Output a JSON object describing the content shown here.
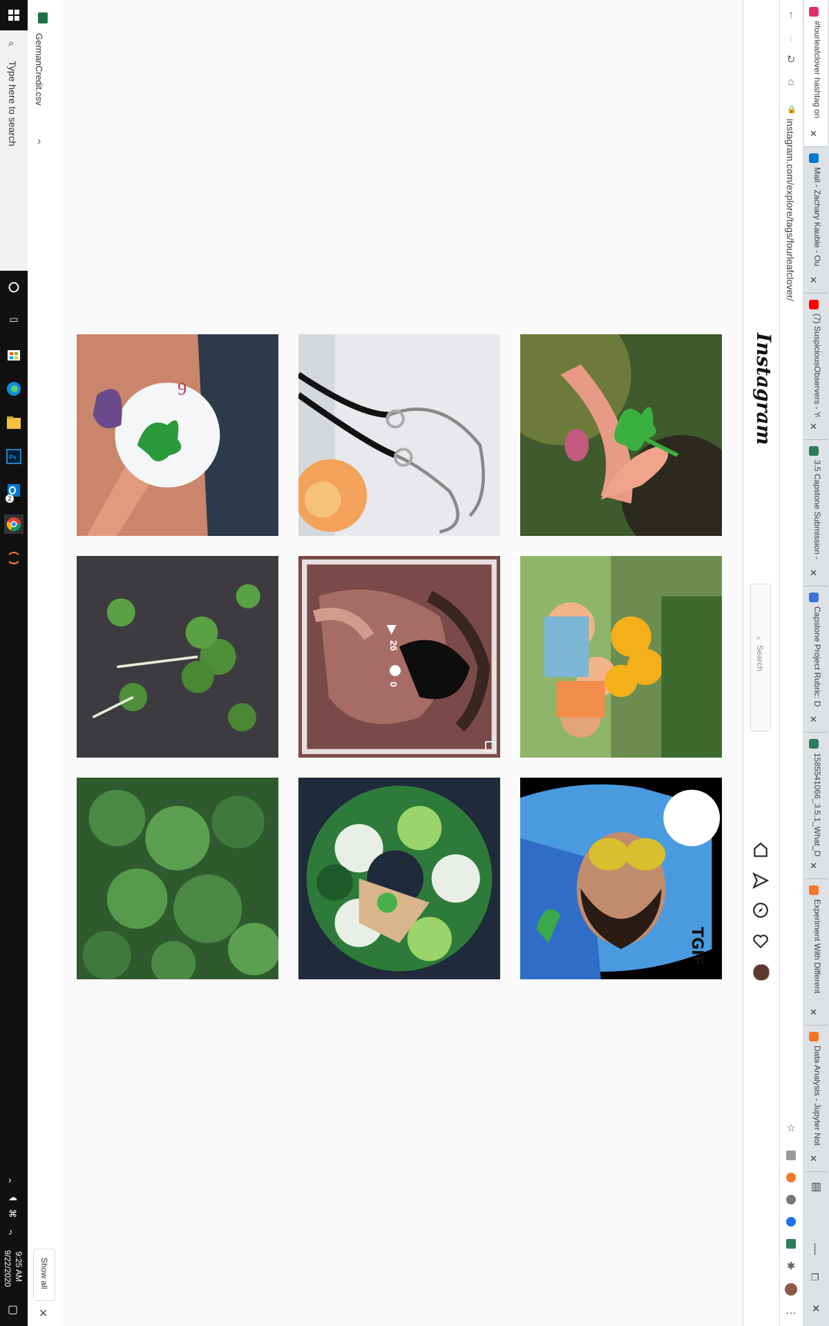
{
  "taskbar": {
    "search_text": "Type here to search",
    "time": "9:25 AM",
    "date": "9/22/2020",
    "edge_badge": "2"
  },
  "downloads": {
    "file_name": "GermanCredit.csv",
    "show_all_label": "Show all"
  },
  "status_url": "https://www.instagram.com/p/CF58JSfAuzE/",
  "browser": {
    "address": "instagram.com/explore/tags/fourleafclover/",
    "tabs": [
      {
        "title": "#fourleafclover hashtag on",
        "color": "#e1306c"
      },
      {
        "title": "Mail - Zachary Kauble - Ou",
        "color": "#0078d4"
      },
      {
        "title": "(7) SuspiciousObservers - Yo",
        "color": "#ff0000"
      },
      {
        "title": "3.5 Capstone Submission -",
        "color": "#2e7d5b"
      },
      {
        "title": "Capstone Project Rubric: D",
        "color": "#3b73d8"
      },
      {
        "title": "1585541066_3.5.1_What_D",
        "color": "#2e7d5b"
      },
      {
        "title": "Experiment With Different",
        "color": "#f37626"
      },
      {
        "title": "Data Analysis - Jupyter Not",
        "color": "#f37626"
      }
    ]
  },
  "instagram": {
    "logo": "Instagram",
    "search_placeholder": "Search",
    "video_views": "26",
    "video_comments": "0",
    "sticker_text": "TGIF"
  },
  "posts": [
    {
      "subject": "golf-ball-clover"
    },
    {
      "subject": "clover-necklaces-rose"
    },
    {
      "subject": "hand-holding-clover"
    },
    {
      "subject": "clovers-on-dark-surface"
    },
    {
      "subject": "man-with-sunglasses-video"
    },
    {
      "subject": "family-sunflowers"
    },
    {
      "subject": "clover-patch"
    },
    {
      "subject": "green-white-wreath"
    },
    {
      "subject": "man-sunglasses-tgif"
    }
  ]
}
